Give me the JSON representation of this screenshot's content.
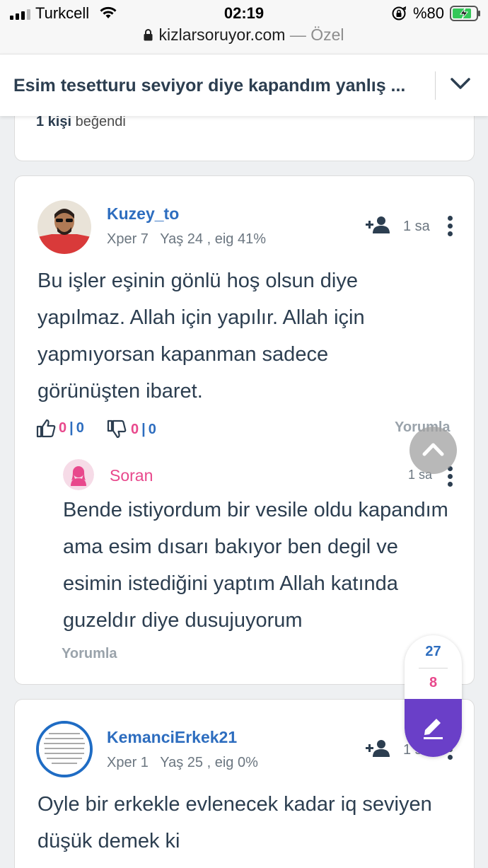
{
  "status_bar": {
    "carrier": "Turkcell",
    "time": "02:19",
    "battery": "%80"
  },
  "url_bar": {
    "domain": "kizlarsoruyor.com",
    "mode": "— Özel"
  },
  "header": {
    "title": "Esim tesetturu seviyor diye kapandım yanlış ..."
  },
  "prev_card": {
    "likes_count": "1 kişi",
    "likes_text": "beğendi"
  },
  "answer": {
    "username": "Kuzey_to",
    "xper": "Xper 7",
    "age": "Yaş 24 , eig 41%",
    "time": "1 sa",
    "text": "Bu işler eşinin gönlü hoş olsun diye yapılmaz. Allah için yapılır. Allah için yapmıyorsan kapanman sadece görünüşten ibaret.",
    "like_a": "0",
    "like_b": "0",
    "dislike_a": "0",
    "dislike_b": "0",
    "separator": "|",
    "comment_label": "Yorumla"
  },
  "reply": {
    "username": "Soran",
    "time": "1 sa",
    "text": "Bende istiyordum bir vesile oldu kapandım ama esim dısarı bakıyor ben degil ve esimin istediğini yaptım Allah katında guzeldır diye dusujuyorum",
    "comment_label": "Yorumla"
  },
  "answer2": {
    "username": "KemanciErkek21",
    "xper": "Xper 1",
    "age": "Yaş 25 , eig 0%",
    "time": "1 sa",
    "text": "Oyle bir erkekle evlenecek kadar iq seviyen düşük demek ki"
  },
  "vote_pill": {
    "up": "27",
    "down": "8"
  },
  "colors": {
    "username_blue": "#2d6dbf",
    "asker_pink": "#e8488c",
    "write_purple": "#6a3fc8",
    "text_dark": "#2c3e50"
  },
  "icons": [
    "signal-icon",
    "wifi-icon",
    "orientation-lock-icon",
    "battery-charging-icon",
    "lock-icon",
    "chevron-down-icon",
    "add-user-icon",
    "more-vertical-icon",
    "thumbs-up-icon",
    "thumbs-down-icon",
    "chevron-up-icon",
    "pencil-icon"
  ]
}
